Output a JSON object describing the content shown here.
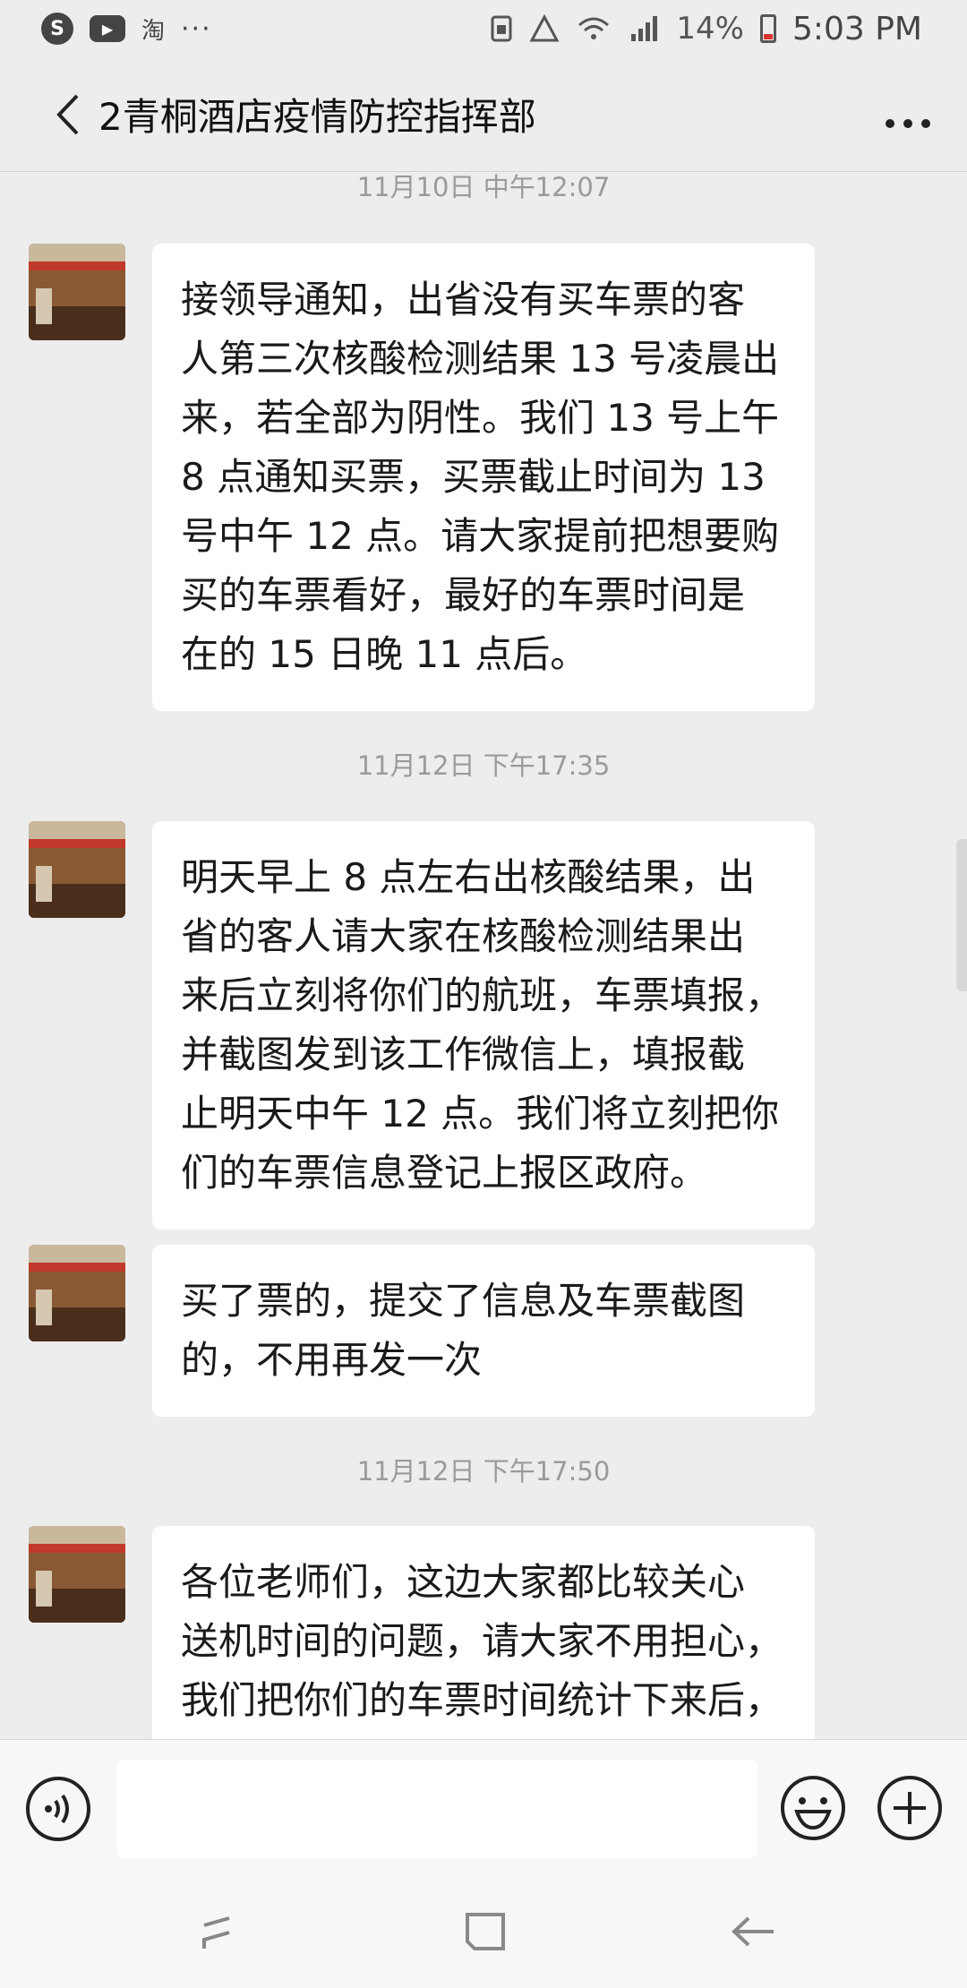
{
  "status_bar": {
    "left_icons": [
      "skype-icon",
      "youtube-icon",
      "taobao-icon",
      "more-dots"
    ],
    "taobao_glyph": "淘",
    "more_glyph": "···",
    "battery": "14%",
    "time": "5:03 PM"
  },
  "header": {
    "title": "2青桐酒店疫情防控指挥部"
  },
  "messages": [
    {
      "timestamp": "11月10日 中午12:07",
      "lines": [
        "接领导通知，出省没有买车票的客",
        "人第三次核酸检测结果 13 号凌晨出",
        "来，若全部为阴性。我们 13 号上午",
        "8 点通知买票，买票截止时间为 13",
        "号中午 12 点。请大家提前把想要购",
        "买的车票看好，最好的车票时间是",
        "在的 15 日晚 11 点后。"
      ]
    },
    {
      "timestamp": "11月12日 下午17:35",
      "lines": [
        "明天早上 8 点左右出核酸结果，出",
        "省的客人请大家在核酸检测结果出",
        "来后立刻将你们的航班，车票填报，",
        "并截图发到该工作微信上，填报截",
        "止明天中午 12 点。我们将立刻把你",
        "们的车票信息登记上报区政府。"
      ]
    },
    {
      "lines": [
        "买了票的，提交了信息及车票截图",
        "的，不用再发一次"
      ]
    },
    {
      "timestamp": "11月12日 下午17:50",
      "lines": [
        "各位老师们，这边大家都比较关心",
        "送机时间的问题，请大家不用担心，",
        "我们把你们的车票时间统计下来后，"
      ]
    }
  ],
  "colors": {
    "background": "#ededed",
    "bubble": "#ffffff",
    "timestamp": "#9a9a9a",
    "battery_low": "#dd3333"
  }
}
